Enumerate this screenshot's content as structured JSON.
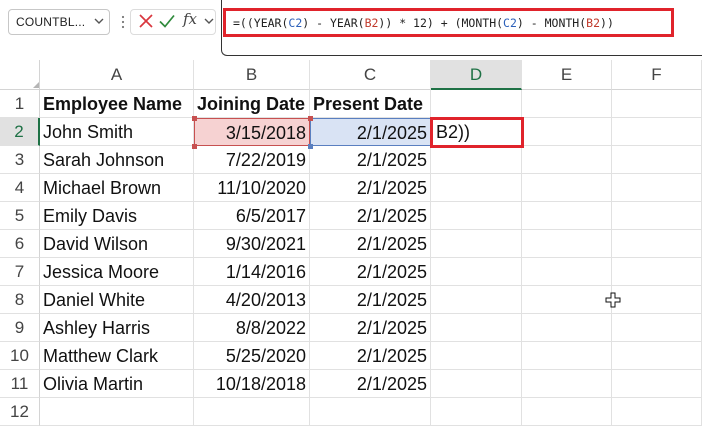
{
  "formula_bar": {
    "name_box": "COUNTBL...",
    "formula_parts": [
      {
        "text": "=((YEAR(",
        "kind": "plain"
      },
      {
        "text": "C2",
        "kind": "ref-c2"
      },
      {
        "text": ") - YEAR(",
        "kind": "plain"
      },
      {
        "text": "B2",
        "kind": "ref-b2"
      },
      {
        "text": ")) * 12) + (MONTH(",
        "kind": "plain"
      },
      {
        "text": "C2",
        "kind": "ref-c2"
      },
      {
        "text": ") - MONTH(",
        "kind": "plain"
      },
      {
        "text": "B2",
        "kind": "ref-b2"
      },
      {
        "text": "))",
        "kind": "plain"
      }
    ],
    "icons": {
      "cancel": "x-icon",
      "enter": "check-icon",
      "function": "fx"
    }
  },
  "columns": [
    "A",
    "B",
    "C",
    "D",
    "E",
    "F"
  ],
  "selected_column": "D",
  "rows": [
    "1",
    "2",
    "3",
    "4",
    "5",
    "6",
    "7",
    "8",
    "9",
    "10",
    "11",
    "12"
  ],
  "selected_row": "2",
  "headers": {
    "employee_name": "Employee Name",
    "joining_date": "Joining Date",
    "present_date": "Present Date"
  },
  "employees": [
    {
      "name": "John Smith",
      "joining": "3/15/2018",
      "present": "2/1/2025"
    },
    {
      "name": "Sarah Johnson",
      "joining": "7/22/2019",
      "present": "2/1/2025"
    },
    {
      "name": "Michael Brown",
      "joining": "11/10/2020",
      "present": "2/1/2025"
    },
    {
      "name": "Emily Davis",
      "joining": "6/5/2017",
      "present": "2/1/2025"
    },
    {
      "name": "David Wilson",
      "joining": "9/30/2021",
      "present": "2/1/2025"
    },
    {
      "name": "Jessica Moore",
      "joining": "1/14/2016",
      "present": "2/1/2025"
    },
    {
      "name": "Daniel White",
      "joining": "4/20/2013",
      "present": "2/1/2025"
    },
    {
      "name": "Ashley Harris",
      "joining": "8/8/2022",
      "present": "2/1/2025"
    },
    {
      "name": "Matthew Clark",
      "joining": "5/25/2020",
      "present": "2/1/2025"
    },
    {
      "name": "Olivia Martin",
      "joining": "10/18/2018",
      "present": "2/1/2025"
    }
  ],
  "active_cell": {
    "ref": "D2",
    "editing_text": "B2))"
  },
  "colors": {
    "accent": "#1e7145",
    "highlight_red": "#e0232b",
    "ref_blue": "#2b5fb9",
    "ref_red": "#c0392b"
  }
}
